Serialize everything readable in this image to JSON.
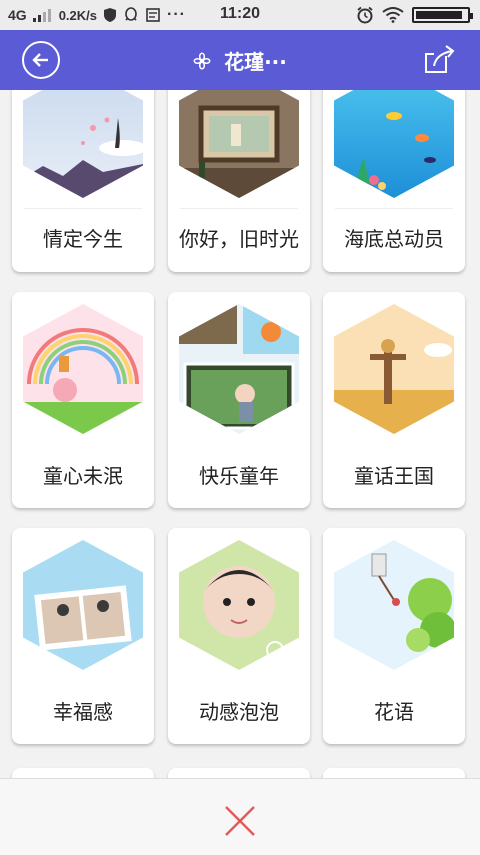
{
  "status_bar": {
    "network": "4G",
    "speed": "0.2K/s",
    "time": "11:20",
    "battery_level": 0.92,
    "icons": [
      "signal-icon",
      "shield-icon",
      "qq-icon",
      "message-icon",
      "more-dots-icon",
      "alarm-icon",
      "wifi-icon",
      "battery-icon"
    ]
  },
  "header": {
    "title": "花瑾···",
    "title_icon": "flower-icon",
    "back_icon": "back-arrow-icon",
    "share_icon": "share-icon",
    "background": "#5b5bd6"
  },
  "templates": [
    {
      "label": "情定今生",
      "theme": "romance"
    },
    {
      "label": "你好，旧时光",
      "theme": "vintage"
    },
    {
      "label": "海底总动员",
      "theme": "ocean"
    },
    {
      "label": "童心未泯",
      "theme": "rainbow"
    },
    {
      "label": "快乐童年",
      "theme": "childhood"
    },
    {
      "label": "童话王国",
      "theme": "fairytale"
    },
    {
      "label": "幸福感",
      "theme": "happiness"
    },
    {
      "label": "动感泡泡",
      "theme": "bubbles"
    },
    {
      "label": "花语",
      "theme": "flowers"
    }
  ],
  "footer": {
    "close_icon": "close-icon",
    "close_color": "#e05a5a"
  }
}
